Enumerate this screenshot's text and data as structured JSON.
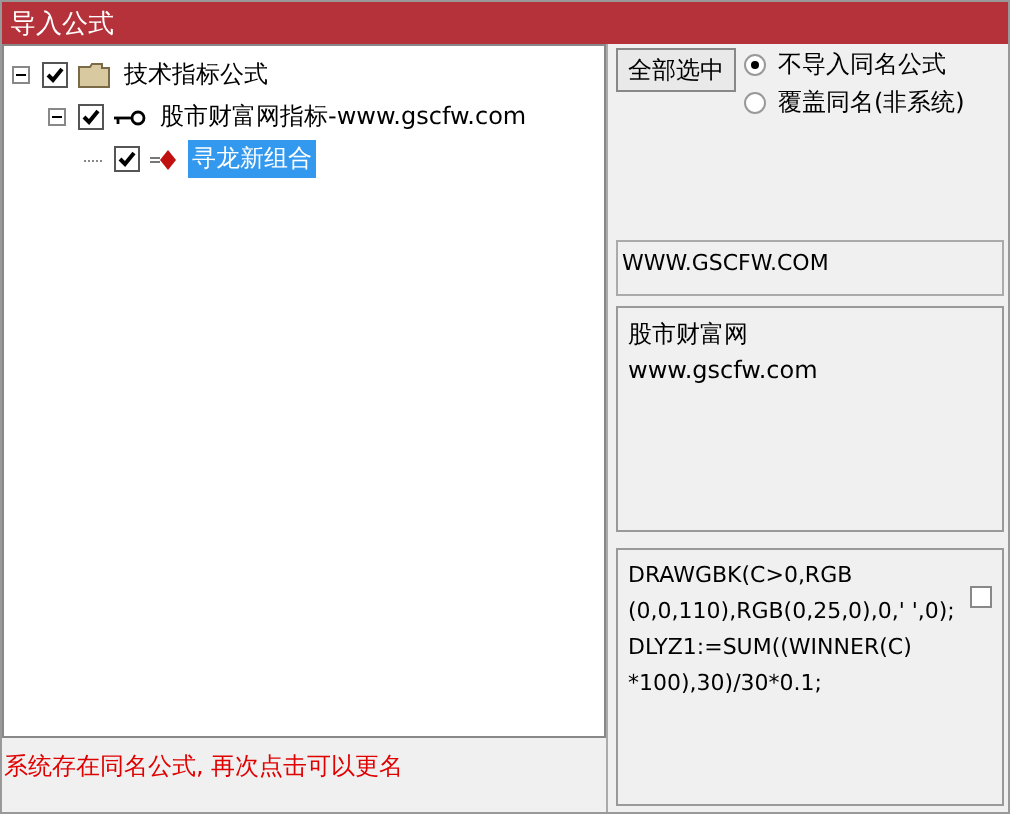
{
  "window": {
    "title": "导入公式"
  },
  "tree": [
    {
      "label": "技术指标公式",
      "kind": "folder",
      "checked": true,
      "expanded": true,
      "selected": false,
      "children": [
        {
          "label": "股市财富网指标-www.gscfw.com",
          "kind": "indicator",
          "checked": true,
          "expanded": true,
          "selected": false,
          "children": [
            {
              "label": "寻龙新组合",
              "kind": "formula",
              "checked": true,
              "selected": true
            }
          ]
        }
      ]
    }
  ],
  "select_all_button": "全部选中",
  "radios": [
    {
      "label": "不导入同名公式",
      "selected": true
    },
    {
      "label": "覆盖同名(非系统)",
      "selected": false
    }
  ],
  "website_field": {
    "value": "WWW.GSCFW.COM"
  },
  "description": [
    "股市财富网",
    "www.gscfw.com"
  ],
  "code": {
    "lines": [
      "DRAWGBK(C>0,RGB",
      "(0,0,110),RGB(0,25,0),0,' ',0);",
      "DLYZ1:=SUM((WINNER(C)",
      "*100),30)/30*0.1;"
    ],
    "checked": false
  },
  "status_bar": "系统存在同名公式, 再次点击可以更名"
}
